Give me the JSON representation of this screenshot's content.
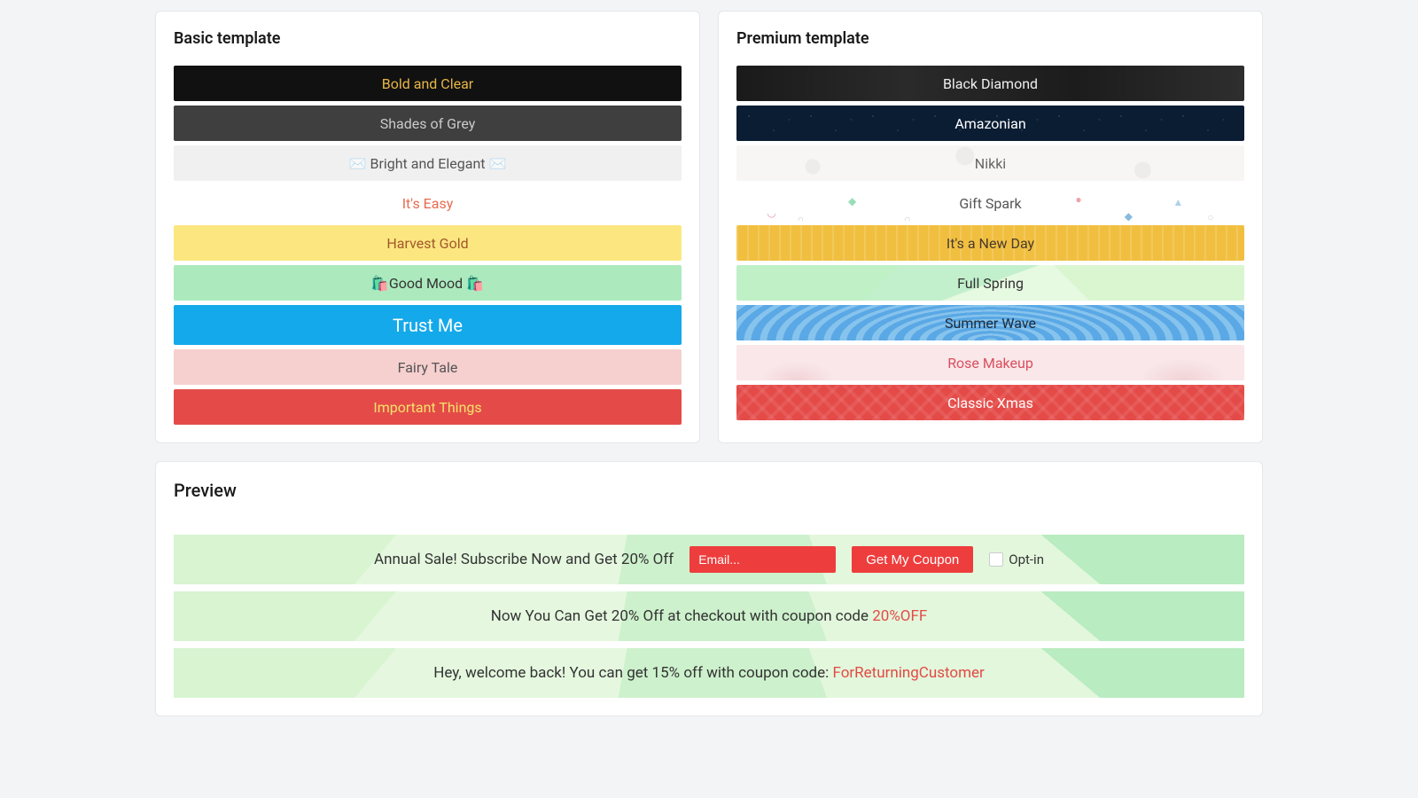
{
  "basic": {
    "title": "Basic template",
    "items": [
      {
        "label": "Bold and Clear"
      },
      {
        "label": "Shades of Grey"
      },
      {
        "label": "Bright and Elegant"
      },
      {
        "label": "It's Easy"
      },
      {
        "label": "Harvest Gold"
      },
      {
        "label": "Good Mood"
      },
      {
        "label": "Trust Me"
      },
      {
        "label": "Fairy Tale"
      },
      {
        "label": "Important Things"
      }
    ]
  },
  "premium": {
    "title": "Premium template",
    "items": [
      {
        "label": "Black Diamond"
      },
      {
        "label": "Amazonian"
      },
      {
        "label": "Nikki"
      },
      {
        "label": "Gift Spark"
      },
      {
        "label": "It's a New Day"
      },
      {
        "label": "Full Spring"
      },
      {
        "label": "Summer Wave"
      },
      {
        "label": "Rose Makeup"
      },
      {
        "label": "Classic Xmas"
      }
    ]
  },
  "preview": {
    "title": "Preview",
    "bar1": {
      "text": "Annual Sale! Subscribe Now and Get 20% Off",
      "email_placeholder": "Email...",
      "button": "Get My Coupon",
      "optin": "Opt-in"
    },
    "bar2": {
      "prefix": "Now You Can Get 20% Off at checkout with coupon code ",
      "code": "20%OFF"
    },
    "bar3": {
      "prefix": "Hey, welcome back! You can get 15% off with coupon code: ",
      "code": "ForReturningCustomer"
    }
  }
}
